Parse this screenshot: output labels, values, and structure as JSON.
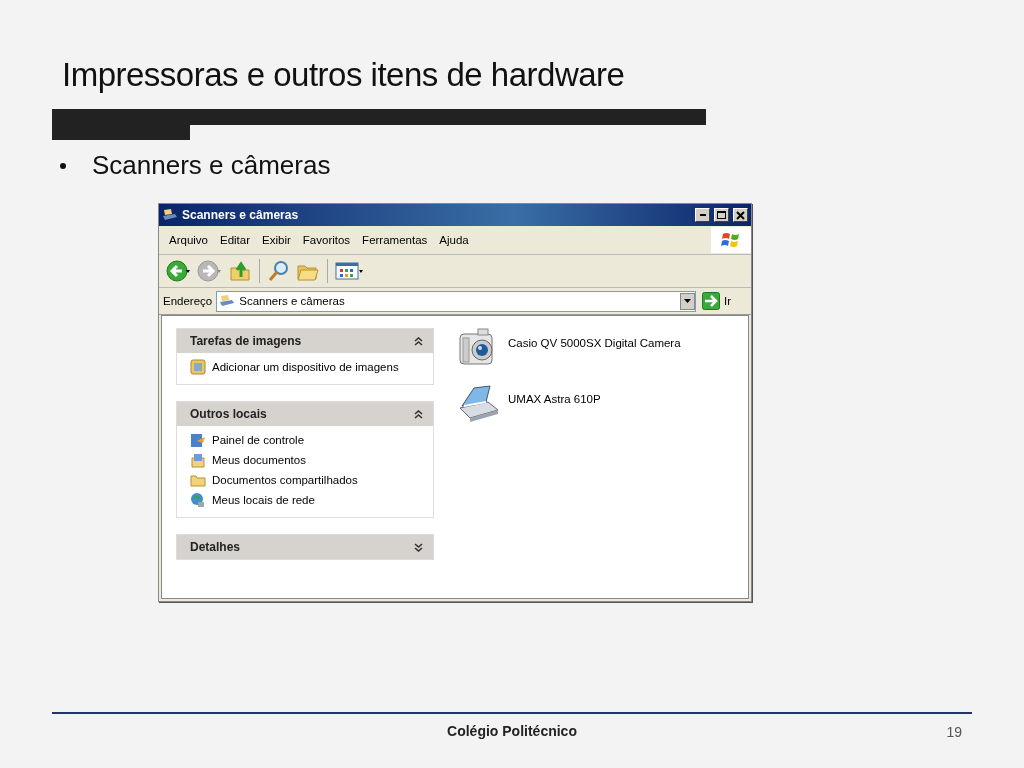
{
  "slide": {
    "title": "Impressoras e outros itens de hardware",
    "bullets": [
      "Scanners e câmeras"
    ],
    "footer": "Colégio Politécnico",
    "page_number": "19"
  },
  "window": {
    "title": "Scanners e câmeras",
    "menu": [
      "Arquivo",
      "Editar",
      "Exibir",
      "Favoritos",
      "Ferramentas",
      "Ajuda"
    ],
    "address": {
      "label": "Endereço",
      "value": "Scanners e câmeras",
      "go": "Ir"
    },
    "panels": [
      {
        "title": "Tarefas de imagens",
        "expanded": true,
        "items": [
          "Adicionar um dispositivo de imagens"
        ]
      },
      {
        "title": "Outros locais",
        "expanded": true,
        "items": [
          "Painel de controle",
          "Meus documentos",
          "Documentos compartilhados",
          "Meus locais de rede"
        ]
      },
      {
        "title": "Detalhes",
        "expanded": false
      }
    ],
    "devices": [
      {
        "name": "Casio QV 5000SX Digital Camera",
        "kind": "camera"
      },
      {
        "name": "UMAX Astra 610P",
        "kind": "scanner"
      }
    ]
  }
}
